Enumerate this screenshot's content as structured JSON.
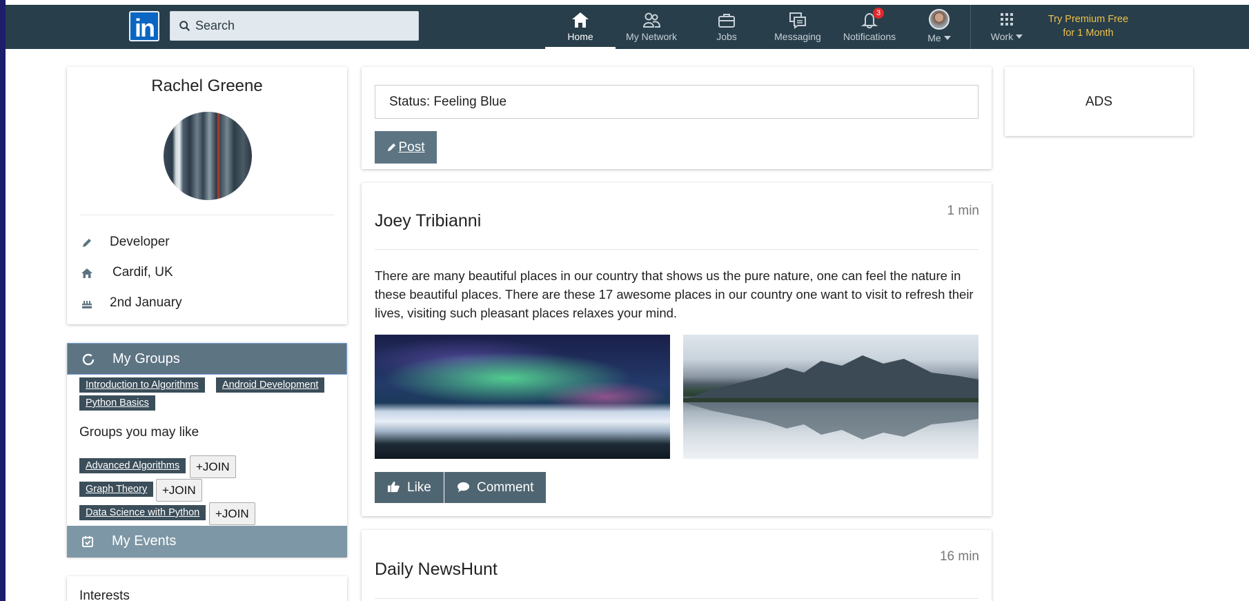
{
  "nav": {
    "logo_text": "in",
    "search_placeholder": "Search",
    "items": [
      {
        "label": "Home"
      },
      {
        "label": "My Network"
      },
      {
        "label": "Jobs"
      },
      {
        "label": "Messaging"
      },
      {
        "label": "Notifications",
        "badge": "3"
      },
      {
        "label": "Me"
      },
      {
        "label": "Work"
      }
    ],
    "premium_line1": "Try Premium Free",
    "premium_line2": "for 1 Month"
  },
  "profile": {
    "name": "Rachel Greene",
    "title": "Developer",
    "location": "Cardif, UK",
    "birthday": "2nd January"
  },
  "groups": {
    "header": "My Groups",
    "mine": [
      "Introduction to Algorithms",
      "Android Development",
      "Python Basics"
    ],
    "suggest_title": "Groups you may like",
    "suggested": [
      "Advanced Algorithms",
      "Graph Theory",
      "Data Science with Python"
    ],
    "join_label": "+JOIN",
    "events_header": "My Events",
    "interests_title": "Interests"
  },
  "composer": {
    "status_value": "Status: Feeling Blue",
    "post_label": "Post"
  },
  "feed": [
    {
      "author": "Joey Tribianni",
      "time": "1 min",
      "text": "There are many beautiful places in our country that shows us the pure nature, one can feel the nature in these beautiful places. There are these 17 awesome places in our country one want to visit to refresh their lives, visiting such pleasant places relaxes your mind.",
      "like_label": "Like",
      "comment_label": "Comment"
    },
    {
      "author": "Daily NewsHunt",
      "time": "16 min"
    }
  ],
  "ads": {
    "label": "ADS"
  },
  "colors": {
    "navbar": "#283e4a",
    "accent": "#5d7483",
    "badge": "#e0282c",
    "premium": "#f0c14b"
  }
}
